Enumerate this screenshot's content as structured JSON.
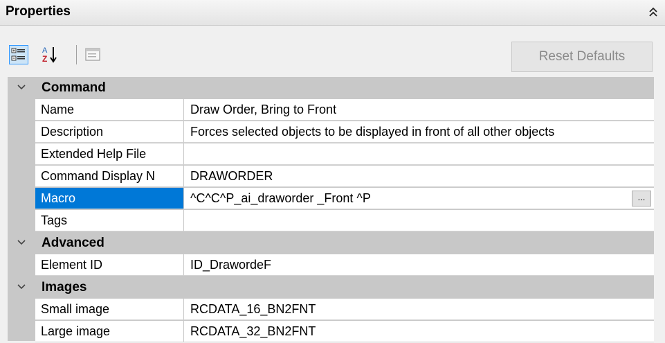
{
  "panel": {
    "title": "Properties",
    "collapse_icon": "double-chevron-up-icon"
  },
  "toolbar": {
    "categorized_icon": "categorized-view-icon",
    "alphabetical_icon": "alphabetical-sort-icon",
    "property_pages_icon": "property-pages-icon",
    "reset_label": "Reset Defaults"
  },
  "categories": {
    "command": {
      "label": "Command",
      "chevron": "∨"
    },
    "advanced": {
      "label": "Advanced",
      "chevron": "∨"
    },
    "images": {
      "label": "Images",
      "chevron": "∨"
    }
  },
  "props": {
    "name": {
      "label": "Name",
      "value": "Draw Order, Bring to Front"
    },
    "description": {
      "label": "Description",
      "value": "Forces selected objects to be displayed in front of all other objects"
    },
    "help_file": {
      "label": "Extended Help File",
      "value": ""
    },
    "display_name": {
      "label": "Command Display N",
      "value": "DRAWORDER"
    },
    "macro": {
      "label": "Macro",
      "value": "^C^C^P_ai_draworder _Front ^P",
      "button": "..."
    },
    "tags": {
      "label": "Tags",
      "value": ""
    },
    "element_id": {
      "label": "Element ID",
      "value": "ID_DrawordeF"
    },
    "small_image": {
      "label": "Small image",
      "value": "RCDATA_16_BN2FNT"
    },
    "large_image": {
      "label": "Large image",
      "value": "RCDATA_32_BN2FNT"
    }
  }
}
